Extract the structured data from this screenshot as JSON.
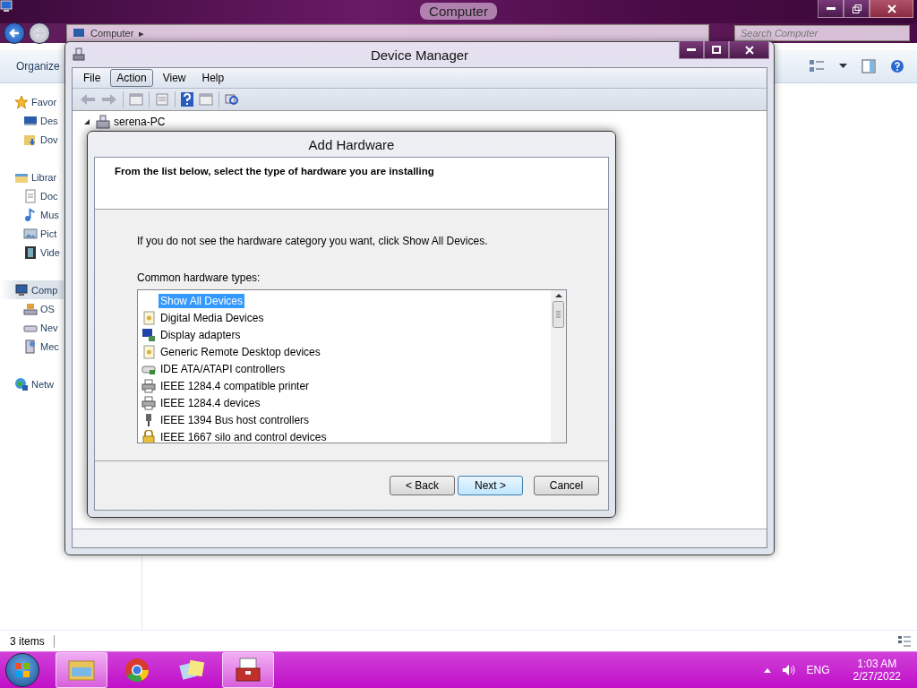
{
  "explorer": {
    "title": "Computer",
    "address": {
      "location": "Computer",
      "separator": "▸"
    },
    "search": {
      "placeholder": "Search Computer"
    },
    "toolbar": {
      "organize": "Organize"
    },
    "nav": [
      {
        "label": "Favor",
        "selected": false,
        "children": [
          {
            "label": "Des",
            "selected": false
          },
          {
            "label": "Dov",
            "selected": false
          }
        ]
      },
      {
        "label": "Librar",
        "selected": false,
        "children": [
          {
            "label": "Doc",
            "selected": false
          },
          {
            "label": "Mus",
            "selected": false
          },
          {
            "label": "Pict",
            "selected": false
          },
          {
            "label": "Vide",
            "selected": false
          }
        ]
      },
      {
        "label": "Comp",
        "selected": true,
        "children": [
          {
            "label": "OS",
            "selected": false
          },
          {
            "label": "Nev",
            "selected": false
          },
          {
            "label": "Mec",
            "selected": false
          }
        ]
      },
      {
        "label": "Netw",
        "selected": false
      }
    ],
    "status": "3 items"
  },
  "device_manager": {
    "title": "Device Manager",
    "menu": [
      {
        "label": "File",
        "selected": false
      },
      {
        "label": "Action",
        "selected": true
      },
      {
        "label": "View",
        "selected": false
      },
      {
        "label": "Help",
        "selected": false
      }
    ],
    "tree": [
      {
        "label": "serena-PC",
        "expanded": true
      }
    ]
  },
  "dialog": {
    "title": "Add Hardware",
    "heading": "From the list below, select the type of hardware you are installing",
    "instruction": "If you do not see the hardware category you want, click Show All Devices.",
    "list_label": "Common hardware types:",
    "items": [
      {
        "label": "Show All Devices",
        "selected": true
      },
      {
        "label": "Digital Media Devices",
        "selected": false
      },
      {
        "label": "Display adapters",
        "selected": false
      },
      {
        "label": "Generic Remote Desktop devices",
        "selected": false
      },
      {
        "label": "IDE ATA/ATAPI controllers",
        "selected": false
      },
      {
        "label": "IEEE 1284.4 compatible printer",
        "selected": false
      },
      {
        "label": "IEEE 1284.4 devices",
        "selected": false
      },
      {
        "label": "IEEE 1394 Bus host controllers",
        "selected": false
      },
      {
        "label": "IEEE 1667 silo and control devices",
        "selected": false
      }
    ],
    "buttons": [
      {
        "label": "< Back",
        "default": false
      },
      {
        "label": "Next >",
        "default": true
      },
      {
        "label": "Cancel",
        "default": false
      }
    ]
  },
  "taskbar": {
    "apps": [
      {
        "running": true
      },
      {
        "running": false
      },
      {
        "running": false
      },
      {
        "running": true
      }
    ],
    "language": "ENG",
    "time": "1:03 AM",
    "date": "2/27/2022"
  }
}
